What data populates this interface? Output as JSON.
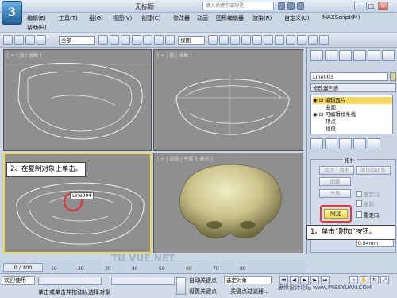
{
  "app": {
    "logo_glyph": "3",
    "window_title": "无标题",
    "search_placeholder": "键入关键字或短语"
  },
  "menu": {
    "items": [
      "编辑(E)",
      "工具(T)",
      "组(G)",
      "视图(V)",
      "创建(C)",
      "修改器",
      "动画",
      "图形编辑器",
      "渲染(R)",
      "自定义(U)",
      "MAXScript(M)"
    ],
    "help": "帮助(H)"
  },
  "toolbar": {
    "selection_filter": "全部",
    "coord_system": "视图"
  },
  "viewports": {
    "top_label": "[ + | 顶 | 线框 ]",
    "front_label": "[ + | 前 | 线框 ]",
    "left_label": "[ + | 左 | 线框 ]",
    "persp_label": "[ + | 透视 | 平滑 + 高光 ]",
    "object_tag": "Line004"
  },
  "command_panel": {
    "object_name": "Line003",
    "modifier_list": "修改器列表",
    "stack": [
      "编辑面片",
      "曲面",
      "可编辑样条线",
      "顶点",
      "线段"
    ],
    "rollout_title": "拓扑",
    "buttons": {
      "add_triangle": "添加三角形",
      "add_quad": "添加四边形",
      "create": "创建",
      "detach": "分离",
      "reorient": "重定向",
      "copy": "复制",
      "attach": "附加",
      "reorient2": "重定向"
    },
    "value_field": "0.54mm"
  },
  "callouts": {
    "step2": "2、在复制对象上单击。",
    "step1": "1、单击“附加”按钮。"
  },
  "timeline": {
    "frame_counter": "0 / 100",
    "ticks": [
      "10",
      "20",
      "30",
      "40",
      "50",
      "60",
      "70",
      "80"
    ]
  },
  "status": {
    "welcome": "欢迎使用 I",
    "prompt": "单击或单击并拖动以选择对象",
    "auto_key": "自动关键点",
    "set_key": "设置关键点",
    "selected_dd": "选定对象",
    "key_filters": "关键点过滤器...",
    "watermark": "思缘设计论坛 www.MISSYUAN.COM",
    "bg_watermark": "TU  VUE.NET"
  },
  "colors": {
    "accent_yellow": "#f1d94a",
    "callout_red": "#e33333",
    "viewport_bg": "#8f8f8f"
  }
}
